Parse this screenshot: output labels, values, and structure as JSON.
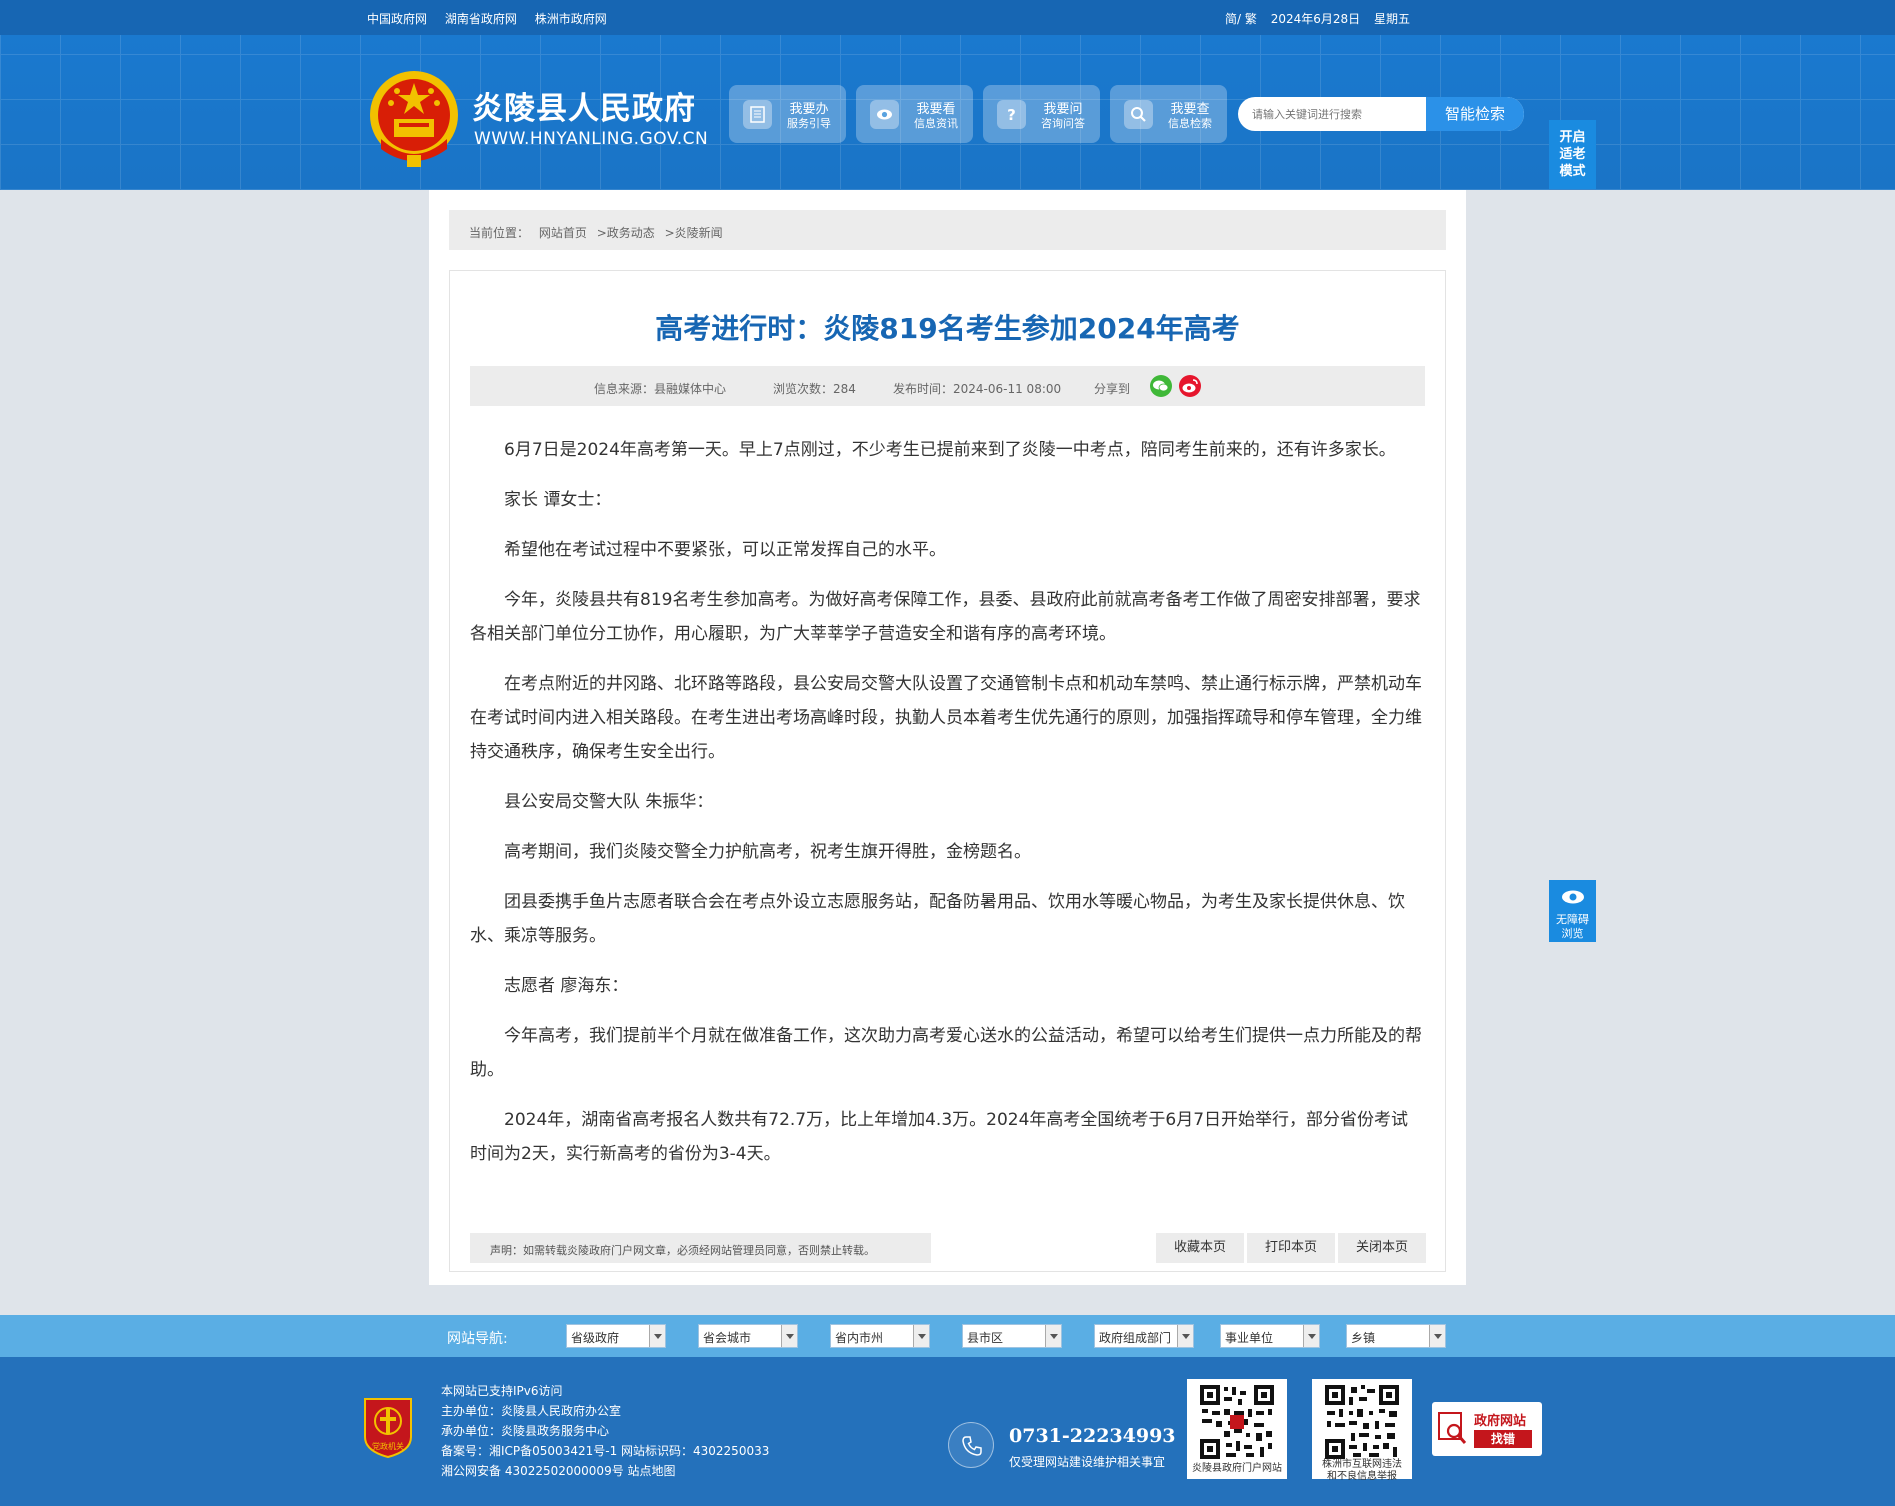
{
  "topbar": {
    "links": [
      "中国政府网",
      "湖南省政府网",
      "株洲市政府网"
    ],
    "lang": "简/ 繁",
    "date": "2024年6月28日",
    "weekday": "星期五"
  },
  "header": {
    "title": "炎陵县人民政府",
    "domain": "WWW.HNYANLING.GOV.CN",
    "services": [
      {
        "l1": "我要办",
        "l2": "服务引导",
        "icon": "document-icon"
      },
      {
        "l1": "我要看",
        "l2": "信息资讯",
        "icon": "eye-icon"
      },
      {
        "l1": "我要问",
        "l2": "咨询问答",
        "icon": "question-icon"
      },
      {
        "l1": "我要查",
        "l2": "信息检索",
        "icon": "magnifier-icon"
      }
    ],
    "search_placeholder": "请输入关键词进行搜索",
    "search_button": "智能检索",
    "elder_mode": [
      "开启",
      "适老",
      "模式"
    ]
  },
  "breadcrumb": [
    "当前位置：",
    "网站首页",
    ">政务动态",
    ">炎陵新闻"
  ],
  "article": {
    "title": "高考进行时：炎陵819名考生参加2024年高考",
    "meta": {
      "source": "信息来源：县融媒体中心",
      "views": "浏览次数：284",
      "time": "发布时间：2024-06-11 08:00",
      "share": "分享到"
    },
    "paragraphs": [
      "6月7日是2024年高考第一天。早上7点刚过，不少考生已提前来到了炎陵一中考点，陪同考生前来的，还有许多家长。",
      "家长 谭女士：",
      "希望他在考试过程中不要紧张，可以正常发挥自己的水平。",
      "今年，炎陵县共有819名考生参加高考。为做好高考保障工作，县委、县政府此前就高考备考工作做了周密安排部署，要求各相关部门单位分工协作，用心履职，为广大莘莘学子营造安全和谐有序的高考环境。",
      "在考点附近的井冈路、北环路等路段，县公安局交警大队设置了交通管制卡点和机动车禁鸣、禁止通行标示牌，严禁机动车在考试时间内进入相关路段。在考生进出考场高峰时段，执勤人员本着考生优先通行的原则，加强指挥疏导和停车管理，全力维持交通秩序，确保考生安全出行。",
      "县公安局交警大队 朱振华：",
      "高考期间，我们炎陵交警全力护航高考，祝考生旗开得胜，金榜题名。",
      "团县委携手鱼片志愿者联合会在考点外设立志愿服务站，配备防暑用品、饮用水等暖心物品，为考生及家长提供休息、饮水、乘凉等服务。",
      "志愿者 廖海东：",
      "今年高考，我们提前半个月就在做准备工作，这次助力高考爱心送水的公益活动，希望可以给考生们提供一点力所能及的帮助。",
      "2024年，湖南省高考报名人数共有72.7万，比上年增加4.3万。2024年高考全国统考于6月7日开始举行，部分省份考试时间为2天，实行新高考的省份为3-4天。"
    ],
    "declaration": "声明：如需转载炎陵政府门户网文章，必须经网站管理员同意，否则禁止转载。",
    "actions": [
      "收藏本页",
      "打印本页",
      "关闭本页"
    ]
  },
  "a11y": [
    "无障碍",
    "浏览"
  ],
  "sitenav": {
    "label": "网站导航:",
    "selects": [
      "省级政府",
      "省会城市",
      "省内市州",
      "县市区",
      "政府组成部门",
      "事业单位",
      "乡镇"
    ]
  },
  "footer": {
    "lines": [
      "本网站已支持IPv6访问",
      "主办单位：炎陵县人民政府办公室",
      "承办单位：炎陵县政务服务中心",
      "备案号：湘ICP备05003421号-1 网站标识码：4302250033",
      "湘公网安备 43022502000009号 站点地图"
    ],
    "phone": "0731-22234993",
    "phone_note": "仅受理网站建设维护相关事宜",
    "qr1_caption": "炎陵县政府门户网站",
    "qr2_caption": [
      "株洲市互联网违法",
      "和不良信息举报"
    ],
    "jiucuo": [
      "政府网站",
      "找错"
    ],
    "party_badge": "党政机关"
  },
  "colors": {
    "primary": "#1766b3",
    "title": "#1766b3",
    "nav": "#5aaee4",
    "footer": "#2471bb"
  }
}
